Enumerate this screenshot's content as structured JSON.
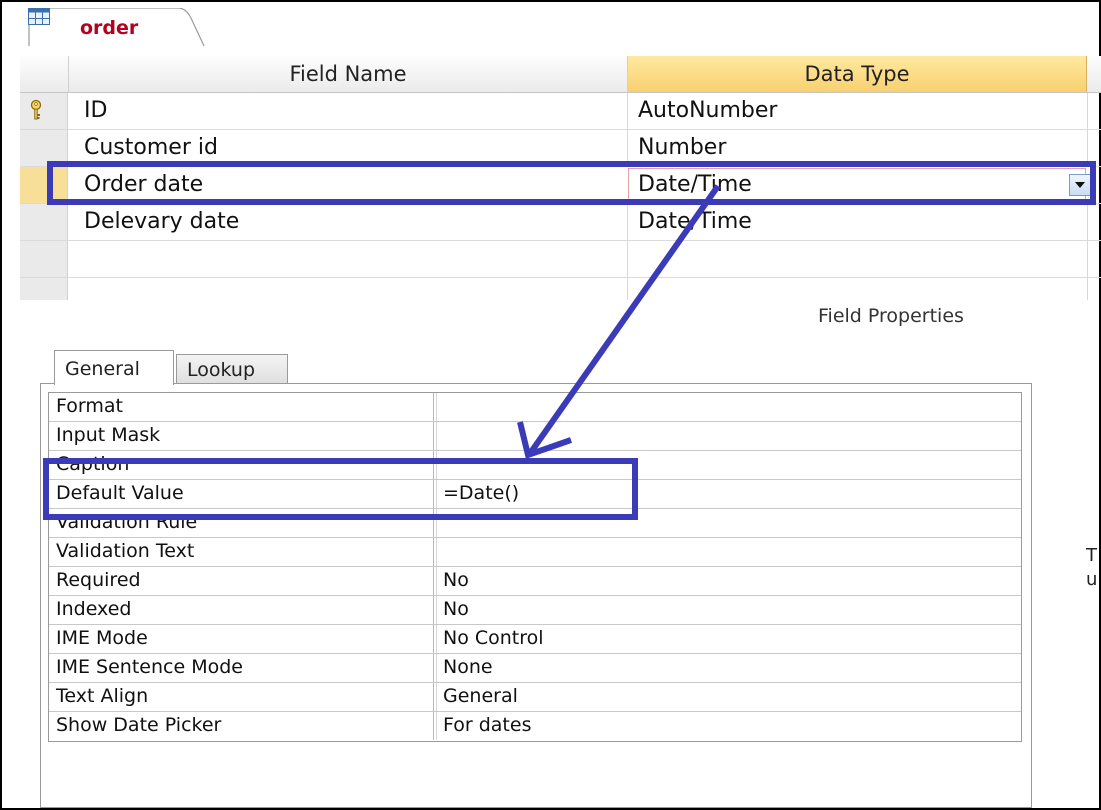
{
  "tab": {
    "label": "order",
    "icon": "table-icon"
  },
  "grid": {
    "headers": {
      "field_name": "Field Name",
      "data_type": "Data Type"
    },
    "rows": [
      {
        "name": "ID",
        "type": "AutoNumber",
        "primary_key": true
      },
      {
        "name": "Customer id",
        "type": "Number"
      },
      {
        "name": "Order date",
        "type": "Date/Time",
        "selected": true
      },
      {
        "name": "Delevary date",
        "type": "Date/Time"
      },
      {
        "name": "",
        "type": ""
      },
      {
        "name": "",
        "type": ""
      }
    ]
  },
  "field_properties": {
    "title": "Field Properties",
    "tabs": [
      "General",
      "Lookup"
    ],
    "active_tab": "General",
    "properties": [
      {
        "name": "Format",
        "value": ""
      },
      {
        "name": "Input Mask",
        "value": ""
      },
      {
        "name": "Caption",
        "value": ""
      },
      {
        "name": "Default Value",
        "value": "=Date()"
      },
      {
        "name": "Validation Rule",
        "value": ""
      },
      {
        "name": "Validation Text",
        "value": ""
      },
      {
        "name": "Required",
        "value": "No"
      },
      {
        "name": "Indexed",
        "value": "No"
      },
      {
        "name": "IME Mode",
        "value": "No Control"
      },
      {
        "name": "IME Sentence Mode",
        "value": "None"
      },
      {
        "name": "Text Align",
        "value": "General"
      },
      {
        "name": "Show Date Picker",
        "value": "For dates"
      }
    ],
    "side_text": [
      "T",
      "u"
    ]
  },
  "colors": {
    "annotation": "#3b3bb8",
    "tab_label": "#b5001f",
    "header_highlight": "#f8d070",
    "current_row": "#f7df9a"
  },
  "icons": {
    "primary_key": "key-icon",
    "dropdown": "chevron-down-icon"
  }
}
